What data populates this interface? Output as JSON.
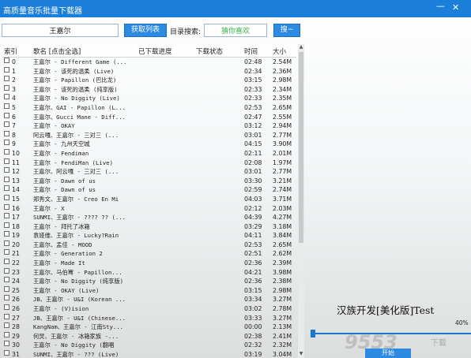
{
  "window": {
    "title": "高质量音乐批量下载器",
    "minimize_glyph": "—",
    "close_glyph": "✕"
  },
  "toolbar": {
    "search_value": "王嘉尔",
    "fetch_button": "获取列表",
    "dir_label": "目录搜索:",
    "dir_value": "猜你喜欢",
    "search_button": "搜~"
  },
  "list": {
    "headers": {
      "index": "索引",
      "name": "歌名 [点击全选]",
      "progress": "已下载进度",
      "status": "下载状态",
      "time": "时间",
      "size": "大小"
    },
    "rows": [
      {
        "idx": "0",
        "name": "王嘉尔 - Different Game (...",
        "time": "02:48",
        "size": "2.54M"
      },
      {
        "idx": "1",
        "name": "王嘉尔 - 该死的温柔 (Live)",
        "time": "02:34",
        "size": "2.36M"
      },
      {
        "idx": "2",
        "name": "王嘉尔 - Papillon (巴比龙)",
        "time": "03:15",
        "size": "2.98M"
      },
      {
        "idx": "3",
        "name": "王嘉尔 - 该死的温柔 (纯享版)",
        "time": "02:33",
        "size": "2.34M"
      },
      {
        "idx": "4",
        "name": "王嘉尔 - No Diggity (Live)",
        "time": "02:33",
        "size": "2.35M"
      },
      {
        "idx": "5",
        "name": "王嘉尔、GAI - Papillon (L...",
        "time": "02:53",
        "size": "2.65M"
      },
      {
        "idx": "6",
        "name": "王嘉尔、Gucci Mane - Diff...",
        "time": "02:47",
        "size": "2.55M"
      },
      {
        "idx": "7",
        "name": "王嘉尔 - OKAY",
        "time": "03:12",
        "size": "2.94M"
      },
      {
        "idx": "8",
        "name": "阿云嘎、王嘉尔 - 三对三 (...",
        "time": "03:01",
        "size": "2.77M"
      },
      {
        "idx": "9",
        "name": "王嘉尔 - 九州天空城",
        "time": "04:15",
        "size": "3.90M"
      },
      {
        "idx": "10",
        "name": "王嘉尔 - Fendiman",
        "time": "02:11",
        "size": "2.01M"
      },
      {
        "idx": "11",
        "name": "王嘉尔 - FendiMan (Live)",
        "time": "02:08",
        "size": "1.97M"
      },
      {
        "idx": "12",
        "name": "王嘉尔、阿云嘎 - 三对三 (...",
        "time": "03:01",
        "size": "2.77M"
      },
      {
        "idx": "13",
        "name": "王嘉尔 - Dawn of us",
        "time": "03:30",
        "size": "3.21M"
      },
      {
        "idx": "14",
        "name": "王嘉尔 - Dawn of us",
        "time": "02:59",
        "size": "2.74M"
      },
      {
        "idx": "15",
        "name": "郑秀文、王嘉尔 - Creo En Mi",
        "time": "04:03",
        "size": "3.71M"
      },
      {
        "idx": "16",
        "name": "王嘉尔 - X",
        "time": "02:12",
        "size": "2.03M"
      },
      {
        "idx": "17",
        "name": "SUNMI、王嘉尔 - ???? ?? (...",
        "time": "04:39",
        "size": "4.27M"
      },
      {
        "idx": "18",
        "name": "王嘉尔 - 拜托了冰箱",
        "time": "03:29",
        "size": "3.18M"
      },
      {
        "idx": "19",
        "name": "袁娅维、王嘉尔 - Lucky?Rain",
        "time": "04:11",
        "size": "3.84M"
      },
      {
        "idx": "20",
        "name": "王嘉尔、孟佳 - MOOD",
        "time": "02:53",
        "size": "2.65M"
      },
      {
        "idx": "21",
        "name": "王嘉尔 - Generation 2",
        "time": "02:51",
        "size": "2.62M"
      },
      {
        "idx": "22",
        "name": "王嘉尔 - Made It",
        "time": "02:36",
        "size": "2.39M"
      },
      {
        "idx": "23",
        "name": "王嘉尔、马伯骞 - Papillon...",
        "time": "04:21",
        "size": "3.98M"
      },
      {
        "idx": "24",
        "name": "王嘉尔 - No Diggity (纯享版)",
        "time": "02:36",
        "size": "2.38M"
      },
      {
        "idx": "25",
        "name": "王嘉尔 - OKAY (Live)",
        "time": "03:15",
        "size": "2.98M"
      },
      {
        "idx": "26",
        "name": "JB、王嘉尔 - U&I (Korean ...",
        "time": "03:34",
        "size": "3.27M"
      },
      {
        "idx": "26",
        "name": "王嘉尔 - (V)ision",
        "time": "03:02",
        "size": "2.78M"
      },
      {
        "idx": "27",
        "name": "JB、王嘉尔 - U&I (Chinese...",
        "time": "03:33",
        "size": "3.27M"
      },
      {
        "idx": "28",
        "name": "KangNam、王嘉尔 - 江南Sty...",
        "time": "00:00",
        "size": "2.13M"
      },
      {
        "idx": "29",
        "name": "何炅、王嘉尔 - 冰箱家族 -...",
        "time": "02:38",
        "size": "2.41M"
      },
      {
        "idx": "30",
        "name": "王嘉尔 - No Diggity (翻唱",
        "time": "02:32",
        "size": "2.32M"
      },
      {
        "idx": "31",
        "name": "SUNMI、王嘉尔 - ??? (Live)",
        "time": "03:19",
        "size": "3.04M"
      }
    ]
  },
  "brand": "汉族开发[美化版]Test",
  "progress": {
    "label": "40%",
    "fraction": 0.4
  },
  "bottom_button": "开始",
  "watermark": {
    "main": "9553",
    "sub": "下载"
  },
  "colors": {
    "titlebar": "#1b7fd9",
    "button": "#2d8ae3",
    "progress": "#1a78d2"
  }
}
